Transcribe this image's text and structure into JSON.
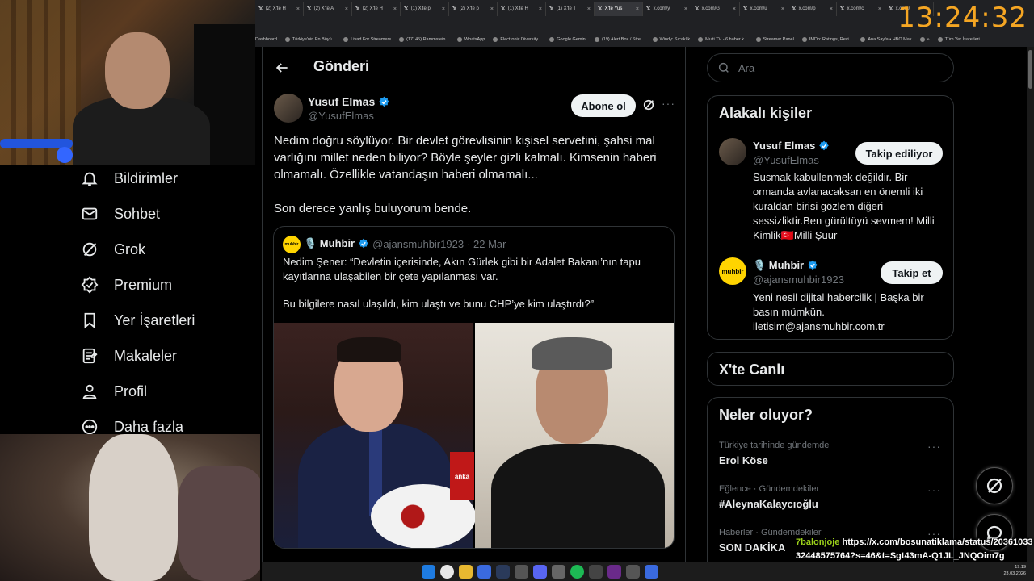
{
  "clock": "13:24:32",
  "browser": {
    "tabs": [
      {
        "label": "(2) X'te H",
        "active": false
      },
      {
        "label": "(2) X'te A",
        "active": false
      },
      {
        "label": "(2) X'te H",
        "active": false
      },
      {
        "label": "(1) X'te p",
        "active": false
      },
      {
        "label": "(2) X'te p",
        "active": false
      },
      {
        "label": "(1) X'te H",
        "active": false
      },
      {
        "label": "(1) X'te T",
        "active": false
      },
      {
        "label": "X'te Yus",
        "active": true
      },
      {
        "label": "x.com/y",
        "active": false
      },
      {
        "label": "x.com/G",
        "active": false
      },
      {
        "label": "x.com/u",
        "active": false
      },
      {
        "label": "x.com/p",
        "active": false
      },
      {
        "label": "x.com/c",
        "active": false
      },
      {
        "label": "x.com/",
        "active": false
      }
    ],
    "bookmarks": [
      "Dashboard",
      "Türkiye'nin En Büyü...",
      "Livad For Streamers",
      "(17145) Rammstein...",
      "WhatsApp",
      "Electronic Diversity...",
      "Google Gemini",
      "(19) Alert Box / Stre...",
      "Windy: Sıcaklık",
      "Multi TV - 6 haber k...",
      "Streamer Panel",
      "IMDb: Ratings, Revi...",
      "Ana Sayfa • HBO Max",
      "»",
      "Tüm Yer İşaretleri"
    ]
  },
  "sidebar": {
    "items": [
      {
        "label": "Bildirimler",
        "icon": "bell-icon"
      },
      {
        "label": "Sohbet",
        "icon": "mail-icon"
      },
      {
        "label": "Grok",
        "icon": "grok-icon"
      },
      {
        "label": "Premium",
        "icon": "verified-badge-icon"
      },
      {
        "label": "Yer İşaretleri",
        "icon": "bookmark-icon"
      },
      {
        "label": "Makaleler",
        "icon": "article-icon"
      },
      {
        "label": "Profil",
        "icon": "person-icon"
      },
      {
        "label": "Daha fazla",
        "icon": "more-circle-icon"
      }
    ]
  },
  "post": {
    "header_title": "Gönderi",
    "author_name": "Yusuf Elmas",
    "author_handle": "@YusufElmas",
    "subscribe_label": "Abone ol",
    "text_p1": "Nedim doğru söylüyor. Bir devlet görevlisinin kişisel servetini, şahsi mal varlığını millet neden biliyor? Böyle şeyler gizli kalmalı. Kimsenin haberi olmamalı. Özellikle vatandaşın haberi olmamalı...",
    "text_p2": "Son derece yanlış buluyorum bende.",
    "quote": {
      "name": "🎙️ Muhbir",
      "handle": "@ajansmuhbir1923",
      "date": "· 22 Mar",
      "avatar_text": "muhbir",
      "text_p1": "Nedim Şener: “Devletin içerisinde, Akın Gürlek gibi bir Adalet Bakanı’nın tapu kayıtlarına ulaşabilen bir çete yapılanması var.",
      "text_p2": "Bu bilgilere nasıl ulaşıldı, kim ulaştı ve bunu CHP’ye kim ulaştırdı?”",
      "image_caption": "anka"
    }
  },
  "right": {
    "search_placeholder": "Ara",
    "related_title": "Alakalı kişiler",
    "related": [
      {
        "name": "Yusuf Elmas",
        "handle": "@YusufElmas",
        "button": "Takip ediliyor",
        "bio": "Susmak kabullenmek değildir. Bir ormanda avlanacaksan en önemli iki kuraldan birisi gözlem diğeri sessizliktir.Ben gürültüyü sevmem! Milli Kimlik🇹🇷Milli Şuur"
      },
      {
        "name": "🎙️ Muhbir",
        "handle": "@ajansmuhbir1923",
        "button": "Takip et",
        "avatar_text": "muhbir",
        "bio": "Yeni nesil dijital habercilik | Başka bir basın mümkün. iletisim@ajansmuhbir.com.tr"
      }
    ],
    "live_title": "X'te Canlı",
    "trends_title": "Neler oluyor?",
    "trends": [
      {
        "category": "Türkiye tarihinde gündemde",
        "name": "Erol Köse"
      },
      {
        "category": "Eğlence · Gündemdekiler",
        "name": "#AleynaKalaycıoğlu"
      },
      {
        "category": "Haberler · Gündemdekiler",
        "name": "SON DAKİKA"
      }
    ]
  },
  "chat": {
    "user": "7balonjoje",
    "message": "https://x.com/bosunatiklama/status/2036103332448575764?s=46&t=Sgt43mA-Q1JL_JNQOim7g"
  },
  "taskbar": {
    "time": "19:19",
    "date": "23.03.2026"
  },
  "colors": {
    "accent": "#1d9bf0",
    "clock": "#f5a623",
    "chat_user": "#9bd11a"
  }
}
